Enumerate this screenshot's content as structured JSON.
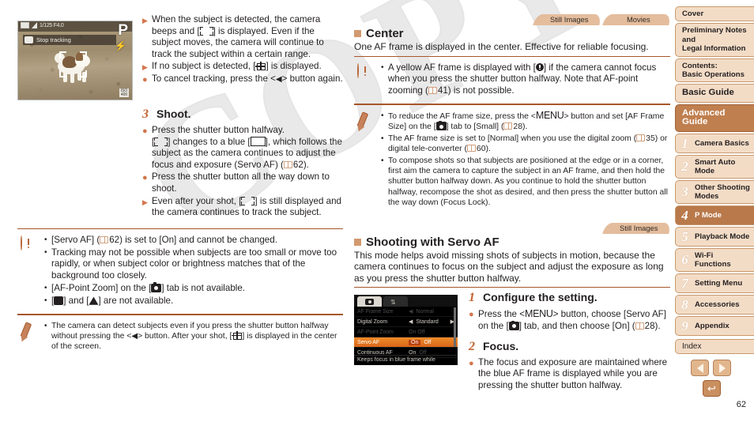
{
  "watermark": "COPY",
  "page_number": "62",
  "left_column": {
    "camera_screen": {
      "mode_label": "P",
      "status_label": "Stop tracking",
      "top_info": "1/125  F4.0",
      "iso_label": "ISO 400"
    },
    "bullets": [
      {
        "marker": "triangle",
        "text": "When the subject is detected, the camera beeps and [ ⬚ ] is displayed. Even if the subject moves, the camera will continue to track the subject within a certain range."
      },
      {
        "marker": "triangle",
        "text": "If no subject is detected, [ ⬚ ] is displayed."
      },
      {
        "marker": "dot",
        "text": "To cancel tracking, press the <◀> button again."
      }
    ],
    "step": {
      "number": "3",
      "title": "Shoot.",
      "items": [
        {
          "marker": "dot",
          "text": "Press the shutter button halfway. [ ] changes to a blue [ ], which follows the subject as the camera continues to adjust the focus and exposure (Servo AF) ( 62)."
        },
        {
          "marker": "dot",
          "text": "Press the shutter button all the way down to shoot."
        },
        {
          "marker": "triangle",
          "text": "Even after your shot, [ ] is still displayed and the camera continues to track the subject."
        }
      ]
    },
    "warning_box": {
      "icon": "exclamation-icon",
      "items": [
        "[Servo AF] ( 62) is set to [On] and cannot be changed.",
        "Tracking may not be possible when subjects are too small or move too rapidly, or when subject color or brightness matches that of the background too closely.",
        "[AF-Point Zoom] on the [ ] tab is not available.",
        "[ ] and [ ] are not available."
      ]
    },
    "note_box": {
      "icon": "pencil-icon",
      "items": [
        "The camera can detect subjects even if you press the shutter button halfway without pressing the <◀> button. After your shot, [ ] is displayed in the center of the screen."
      ]
    }
  },
  "middle_column": {
    "tabs_top": [
      "Still Images",
      "Movies"
    ],
    "center_section": {
      "heading": "Center",
      "subtitle": "One AF frame is displayed in the center. Effective for reliable focusing.",
      "warning_items": [
        "A yellow AF frame is displayed with [ ] if the camera cannot focus when you press the shutter button halfway. Note that AF-point zooming ( 41) is not possible."
      ],
      "note_items": [
        "To reduce the AF frame size, press the <MENU> button and set [AF Frame Size] on the [ ] tab to [Small] ( 28).",
        "The AF frame size is set to [Normal] when you use the digital zoom ( 35) or digital tele-converter ( 60).",
        "To compose shots so that subjects are positioned at the edge or in a corner, first aim the camera to capture the subject in an AF frame, and then hold the shutter button halfway down. As you continue to hold the shutter button halfway, recompose the shot as desired, and then press the shutter button all the way down (Focus Lock)."
      ]
    },
    "tab_still": "Still Images",
    "servo_section": {
      "heading": "Shooting with Servo AF",
      "subtitle": "This mode helps avoid missing shots of subjects in motion, because the camera continues to focus on the subject and adjust the exposure as long as you press the shutter button halfway.",
      "menu_screen": {
        "tab_camera": "camera-tab",
        "tab_settings": "settings-tab",
        "rows": [
          {
            "name": "AF Frame Size",
            "value": "Normal",
            "state": "dim"
          },
          {
            "name": "Digital Zoom",
            "value": "Standard",
            "state": "normal"
          },
          {
            "name": "AF-Point Zoom",
            "value": "On Off",
            "state": "dim"
          },
          {
            "name": "Servo AF",
            "value": "On Off",
            "state": "selected"
          },
          {
            "name": "Continuous AF",
            "value": "On Off",
            "state": "normal"
          }
        ],
        "footer": "Keeps focus in blue frame while"
      },
      "steps": [
        {
          "number": "1",
          "title": "Configure the setting.",
          "items": [
            "Press the <MENU> button, choose [Servo AF] on the [ ] tab, and then choose [On] ( 28)."
          ]
        },
        {
          "number": "2",
          "title": "Focus.",
          "items": [
            "The focus and exposure are maintained where the blue AF frame is displayed while you are pressing the shutter button halfway."
          ]
        }
      ]
    }
  },
  "sidebar": {
    "items": [
      {
        "label": "Cover",
        "type": "plain"
      },
      {
        "label": "Preliminary Notes and\nLegal Information",
        "type": "plain"
      },
      {
        "label": "Contents:\nBasic Operations",
        "type": "plain"
      },
      {
        "label": "Basic Guide",
        "type": "big"
      },
      {
        "label": "Advanced Guide",
        "type": "dark"
      },
      {
        "number": "1",
        "label": "Camera Basics",
        "type": "chapter"
      },
      {
        "number": "2",
        "label": "Smart Auto\nMode",
        "type": "chapter"
      },
      {
        "number": "3",
        "label": "Other Shooting\nModes",
        "type": "chapter"
      },
      {
        "number": "4",
        "label": "P Mode",
        "type": "chapter-selected"
      },
      {
        "number": "5",
        "label": "Playback Mode",
        "type": "chapter"
      },
      {
        "number": "6",
        "label": "Wi-Fi Functions",
        "type": "chapter"
      },
      {
        "number": "7",
        "label": "Setting Menu",
        "type": "chapter"
      },
      {
        "number": "8",
        "label": "Accessories",
        "type": "chapter"
      },
      {
        "number": "9",
        "label": "Appendix",
        "type": "chapter"
      },
      {
        "label": "Index",
        "type": "index"
      }
    ],
    "nav": {
      "prev": "prev-page",
      "next": "next-page",
      "back": "↩"
    }
  }
}
